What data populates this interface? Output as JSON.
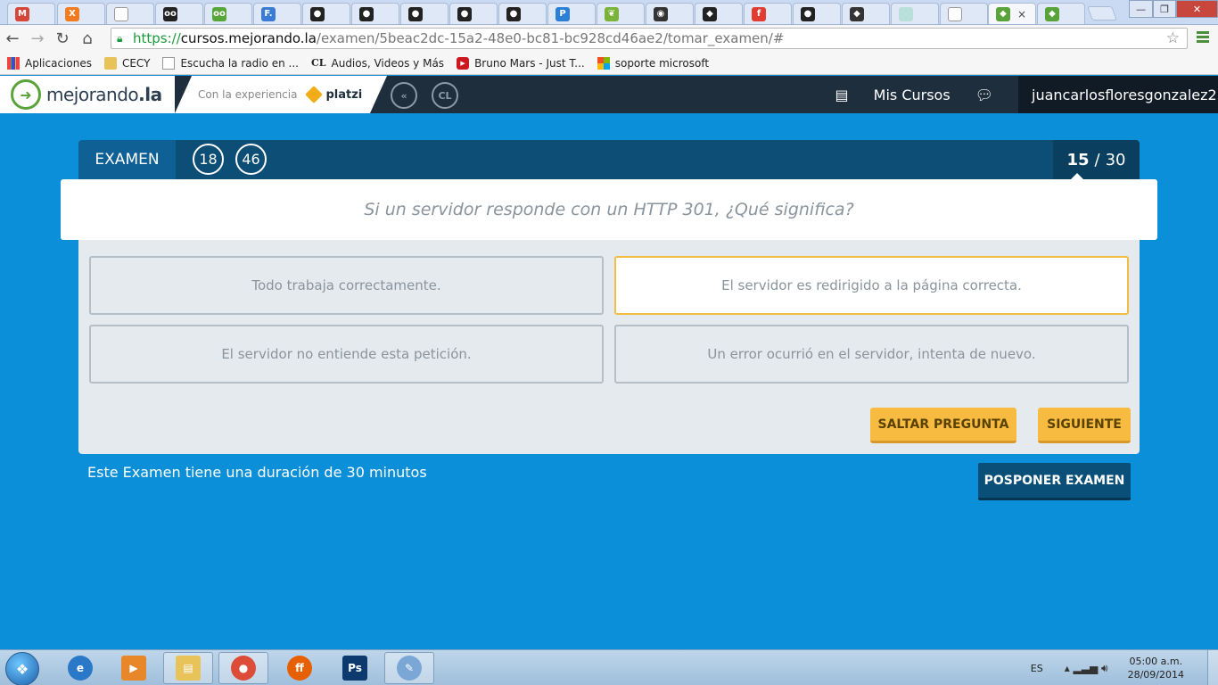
{
  "browser": {
    "tabs": [
      {
        "icon": "gmail-icon",
        "glyph": "M",
        "color": "#d44638"
      },
      {
        "icon": "xampp-icon",
        "glyph": "X",
        "color": "#f47b20"
      },
      {
        "icon": "blank-page-icon",
        "glyph": "",
        "color": "#ffffff"
      },
      {
        "icon": "tripadvisor-icon",
        "glyph": "oo",
        "color": "#222222"
      },
      {
        "icon": "tripadvisor-green-icon",
        "glyph": "oo",
        "color": "#56a63a"
      },
      {
        "icon": "f-letter-icon",
        "glyph": "F.",
        "color": "#3a7bd5"
      },
      {
        "icon": "github-icon",
        "glyph": "●",
        "color": "#222222"
      },
      {
        "icon": "github-icon",
        "glyph": "●",
        "color": "#222222"
      },
      {
        "icon": "github-icon",
        "glyph": "●",
        "color": "#222222"
      },
      {
        "icon": "github-icon",
        "glyph": "●",
        "color": "#222222"
      },
      {
        "icon": "github-icon",
        "glyph": "●",
        "color": "#222222"
      },
      {
        "icon": "p-letter-icon",
        "glyph": "P",
        "color": "#2b7fd4"
      },
      {
        "icon": "leaf-icon",
        "glyph": "❦",
        "color": "#7bb33a"
      },
      {
        "icon": "circle-dot-icon",
        "glyph": "◉",
        "color": "#333333"
      },
      {
        "icon": "cat-icon",
        "glyph": "◆",
        "color": "#222222"
      },
      {
        "icon": "flash-icon",
        "glyph": "f",
        "color": "#e03c31"
      },
      {
        "icon": "github-icon",
        "glyph": "●",
        "color": "#222222"
      },
      {
        "icon": "owl-icon",
        "glyph": "◆",
        "color": "#333333"
      },
      {
        "icon": "image-icon",
        "glyph": "",
        "color": "#b8e0d8"
      },
      {
        "icon": "blank-page-icon",
        "glyph": "",
        "color": "#ffffff"
      },
      {
        "icon": "mejorando-icon",
        "glyph": "◆",
        "color": "#5aa33a",
        "active": true
      },
      {
        "icon": "mejorando-icon",
        "glyph": "◆",
        "color": "#5aa33a"
      }
    ],
    "close_tab": "×",
    "window_controls": [
      "—",
      "❐",
      "✕"
    ],
    "url": {
      "proto": "https://",
      "host": "cursos.mejorando.la",
      "path": "/examen/5beac2dc-15a2-48e0-bc81-bc928cd46ae2/tomar_examen/#"
    },
    "bookmarks": [
      {
        "label": "Aplicaciones",
        "icon": "apps-grid-icon"
      },
      {
        "label": "CECY",
        "icon": "folder-icon"
      },
      {
        "label": "Escucha la radio en ...",
        "icon": "page-icon"
      },
      {
        "label": "Audios, Videos y Más",
        "icon": "cl-icon",
        "prefix": "CL"
      },
      {
        "label": "Bruno Mars - Just T...",
        "icon": "youtube-icon"
      },
      {
        "label": "soporte microsoft",
        "icon": "windows-icon"
      }
    ]
  },
  "site": {
    "logo_text": "mejorando",
    "logo_suffix": ".la",
    "experience_text": "Con la experiencia",
    "platzi_text": "platzi",
    "circle_badges": [
      "«",
      "CL"
    ],
    "nav_label": "Mis Cursos",
    "username": "juancarlosfloresgonzalez2"
  },
  "exam": {
    "title": "EXAMEN",
    "timer_minutes": "18",
    "timer_seconds": "46",
    "current_question": "15",
    "separator": "/",
    "total_questions": "30",
    "question": "Si un servidor responde con un HTTP 301, ¿Qué significa?",
    "answers": [
      {
        "text": "Todo trabaja correctamente.",
        "selected": false
      },
      {
        "text": "El servidor es redirigido a la página correcta.",
        "selected": true
      },
      {
        "text": "El servidor no entiende esta petición.",
        "selected": false
      },
      {
        "text": "Un error ocurrió en el servidor, intenta de nuevo.",
        "selected": false
      }
    ],
    "skip_label": "SALTAR PREGUNTA",
    "next_label": "SIGUIENTE",
    "duration_text": "Este Examen tiene una duración de 30 minutos",
    "postpone_label": "POSPONER EXAMEN"
  },
  "taskbar": {
    "apps": [
      {
        "icon": "internet-explorer-icon",
        "glyph": "e",
        "color": "#2a78c8"
      },
      {
        "icon": "media-player-icon",
        "glyph": "▶",
        "color": "#e8872a"
      },
      {
        "icon": "file-explorer-icon",
        "glyph": "▤",
        "color": "#e8c35a"
      },
      {
        "icon": "chrome-icon",
        "glyph": "●",
        "color": "#dd4b39"
      },
      {
        "icon": "firefox-icon",
        "glyph": "ff",
        "color": "#e66000"
      },
      {
        "icon": "photoshop-icon",
        "glyph": "Ps",
        "color": "#0c3a6e"
      },
      {
        "icon": "paint-icon",
        "glyph": "✎",
        "color": "#7aa7d6"
      }
    ],
    "language": "ES",
    "time": "05:00 a.m.",
    "date": "28/09/2014"
  }
}
